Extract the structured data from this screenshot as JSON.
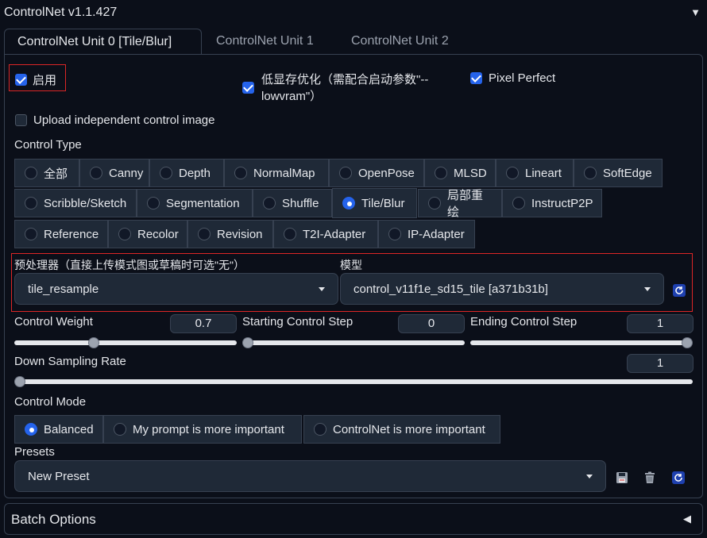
{
  "header": {
    "title": "ControlNet v1.1.427"
  },
  "tabs": [
    {
      "label": "ControlNet Unit 0 [Tile/Blur]",
      "active": true
    },
    {
      "label": "ControlNet Unit 1",
      "active": false
    },
    {
      "label": "ControlNet Unit 2",
      "active": false
    }
  ],
  "options": {
    "enable_label": "启用",
    "enable_checked": true,
    "lowvram_label_line1": "低显存优化（需配合启动参数\"--",
    "lowvram_label_line2": "lowvram\"）",
    "lowvram_checked": true,
    "pixel_perfect_label": "Pixel Perfect",
    "pixel_perfect_checked": true,
    "upload_label": "Upload independent control image",
    "upload_checked": false
  },
  "control_type": {
    "label": "Control Type",
    "selected": "Tile/Blur",
    "items": [
      "全部",
      "Canny",
      "Depth",
      "NormalMap",
      "OpenPose",
      "MLSD",
      "Lineart",
      "SoftEdge",
      "Scribble/Sketch",
      "Segmentation",
      "Shuffle",
      "Tile/Blur",
      "局部重绘",
      "InstructP2P",
      "Reference",
      "Recolor",
      "Revision",
      "T2I-Adapter",
      "IP-Adapter"
    ]
  },
  "preprocessor": {
    "label": "预处理器（直接上传模式图或草稿时可选\"无\"）",
    "value": "tile_resample"
  },
  "model": {
    "label": "模型",
    "value": "control_v11f1e_sd15_tile [a371b31b]"
  },
  "sliders": {
    "control_weight": {
      "label": "Control Weight",
      "value": "0.7",
      "fraction": 0.35
    },
    "starting_step": {
      "label": "Starting Control Step",
      "value": "0",
      "fraction": 0.0
    },
    "ending_step": {
      "label": "Ending Control Step",
      "value": "1",
      "fraction": 1.0
    },
    "down_sampling": {
      "label": "Down Sampling Rate",
      "value": "1",
      "fraction": 0.0
    }
  },
  "control_mode": {
    "label": "Control Mode",
    "selected": "Balanced",
    "items": [
      "Balanced",
      "My prompt is more important",
      "ControlNet is more important"
    ]
  },
  "presets": {
    "label": "Presets",
    "value": "New Preset"
  },
  "batch": {
    "label": "Batch Options"
  },
  "colors": {
    "accent": "#2563eb",
    "highlight": "#dc2626",
    "background": "#0b0f19"
  }
}
